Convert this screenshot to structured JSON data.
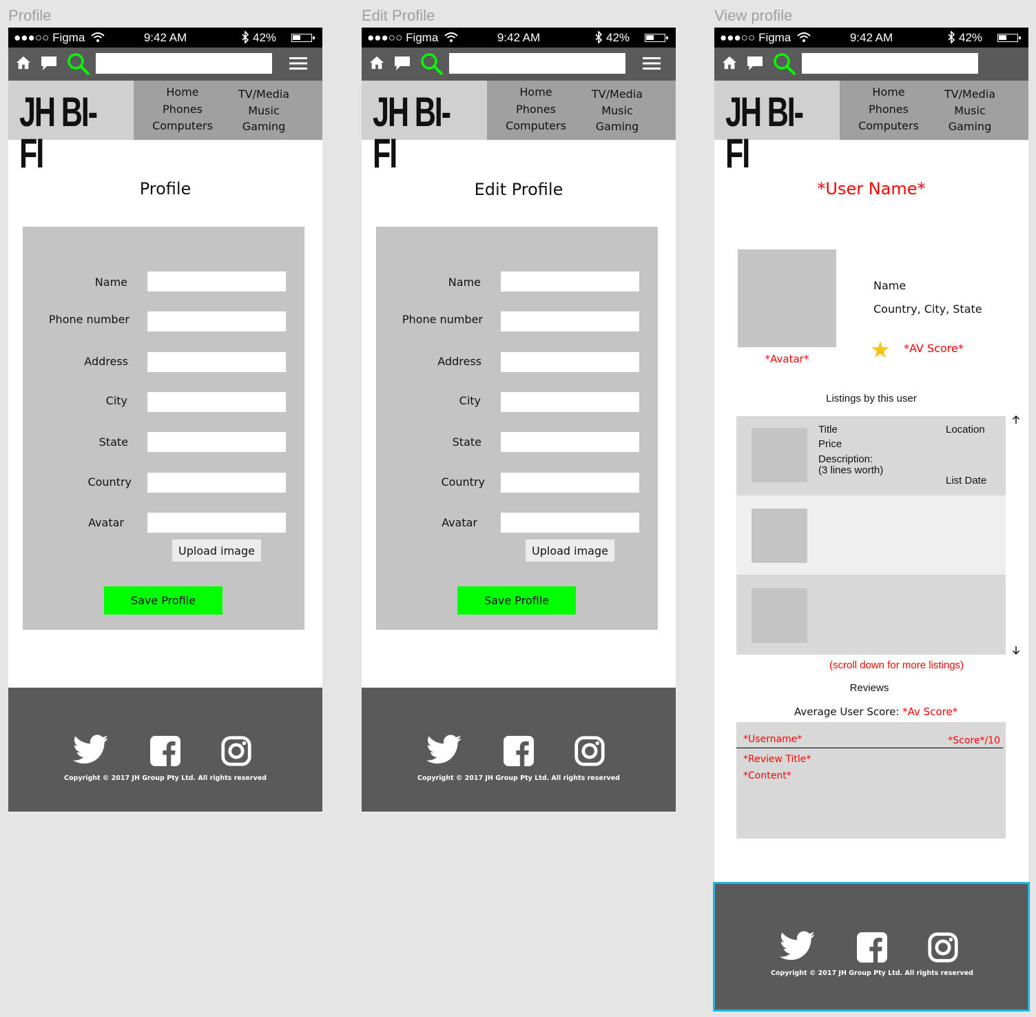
{
  "frames": [
    {
      "label": "Profile",
      "status": {
        "signal": "●●●○○ Figma",
        "time": "9:42 AM",
        "battery": "42%",
        "battery_level": 0.42
      },
      "logo": "JH BI-FI",
      "nav_left": [
        "Home",
        "Phones",
        "Computers"
      ],
      "nav_right": [
        "TV/Media",
        "Music",
        "Gaming"
      ],
      "title": "Profile",
      "form_labels": [
        "Name",
        "Phone number",
        "Address",
        "City",
        "State",
        "Country",
        "Avatar"
      ],
      "upload_label": "Upload image",
      "save_label": "Save Profile",
      "copyright": "Copyright © 2017 JH Group Pty Ltd. All rights reserved"
    },
    {
      "label": "Edit Profile",
      "status": {
        "signal": "●●●○○ Figma",
        "time": "9:42 AM",
        "battery": "42%",
        "battery_level": 0.42
      },
      "logo": "JH BI-FI",
      "nav_left": [
        "Home",
        "Phones",
        "Computers"
      ],
      "nav_right": [
        "TV/Media",
        "Music",
        "Gaming"
      ],
      "title": "Edit Profile",
      "form_labels": [
        "Name",
        "Phone number",
        "Address",
        "City",
        "State",
        "Country",
        "Avatar"
      ],
      "upload_label": "Upload image",
      "save_label": "Save Profile",
      "copyright": "Copyright © 2017 JH Group Pty Ltd. All rights reserved"
    },
    {
      "label": "View profile",
      "status": {
        "signal": "●●●○○ Figma",
        "time": "9:42 AM",
        "battery": "42%",
        "battery_level": 0.42
      },
      "logo": "JH BI-FI",
      "nav_left": [
        "Home",
        "Phones",
        "Computers"
      ],
      "nav_right": [
        "TV/Media",
        "Music",
        "Gaming"
      ],
      "title": "*User Name*",
      "avatar_caption": "*Avatar*",
      "info_name": "Name",
      "info_location": "Country, City, State",
      "av_score": "*AV Score*",
      "listings_heading": "Listings by this user",
      "listing": {
        "title": "Title",
        "price": "Price",
        "description": "Description:",
        "description_note": "(3 lines worth)",
        "location": "Location",
        "list_date": "List Date"
      },
      "scroll_note": "(scroll down for more listings)",
      "reviews_heading": "Reviews",
      "avg_score_label": "Average User Score: ",
      "avg_score_value": "*Av Score*",
      "review": {
        "username": "*Username*",
        "score": "*Score*/10",
        "title": "*Review Title*",
        "content": "*Content*"
      },
      "copyright": "Copyright © 2017 JH Group Pty Ltd. All rights reserved"
    }
  ],
  "colors": {
    "background": "#e5e5e5",
    "statusbar": "#000000",
    "toolbar": "#5a5a5a",
    "search_icon": "#00ff00",
    "logo_bg": "#d0d0d0",
    "nav_bg": "#a0a0a0",
    "form_bg": "#c4c4c4",
    "save_button": "#00ff00",
    "footer": "#5a5a5a",
    "placeholder_red": "#ff0000",
    "star": "#f5c518",
    "selection": "#1cb4e8"
  },
  "icons": [
    "home-icon",
    "chat-icon",
    "search-icon",
    "menu-icon",
    "twitter-icon",
    "facebook-icon",
    "instagram-icon",
    "star-icon",
    "arrow-up-icon",
    "arrow-down-icon",
    "wifi-icon",
    "bluetooth-icon",
    "battery-icon"
  ]
}
